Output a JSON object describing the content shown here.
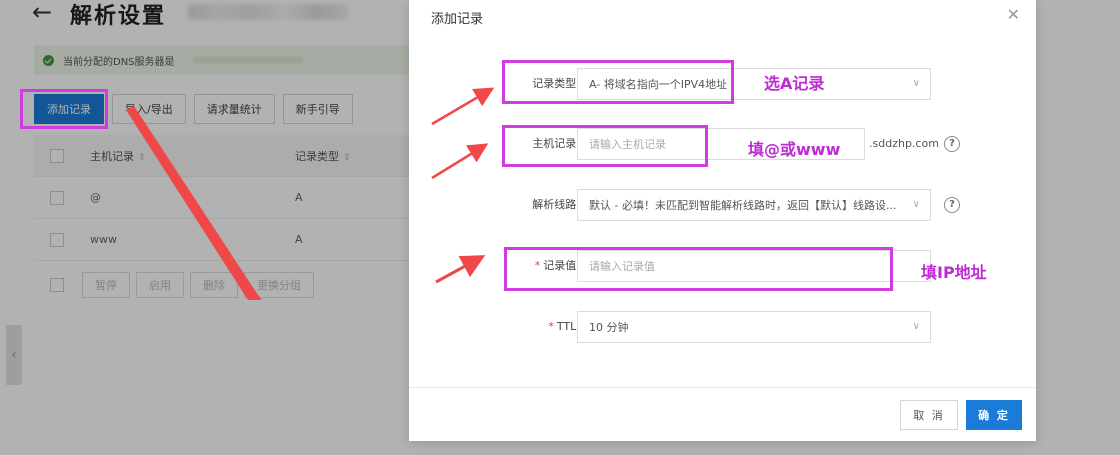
{
  "page": {
    "back_icon": "arrow-left-icon",
    "title": "解析设置",
    "dns_notice": "当前分配的DNS服务器是"
  },
  "toolbar": {
    "add_record": "添加记录",
    "import_export": "导入/导出",
    "request_stats": "请求量统计",
    "guide": "新手引导"
  },
  "table": {
    "headers": {
      "host": "主机记录",
      "type": "记录类型"
    },
    "rows": [
      {
        "host": "@",
        "type": "A"
      },
      {
        "host": "www",
        "type": "A"
      }
    ]
  },
  "bulk_actions": {
    "pause": "暂停",
    "enable": "启用",
    "delete": "删除",
    "change_group": "更换分组"
  },
  "dialog": {
    "title": "添加记录",
    "close_icon": "close-icon",
    "fields": {
      "record_type": {
        "label": "记录类型:",
        "value": "A- 将域名指向一个IPV4地址"
      },
      "host_record": {
        "label": "主机记录:",
        "placeholder": "请输入主机记录",
        "suffix": ".sddzhp.com"
      },
      "resolve_line": {
        "label": "解析线路:",
        "value": "默认 - 必填！未匹配到智能解析线路时，返回【默认】线路设..."
      },
      "record_value": {
        "label": "记录值:",
        "placeholder": "请输入记录值",
        "required": true
      },
      "ttl": {
        "label": "TTL:",
        "value": "10 分钟",
        "required": true
      }
    },
    "cancel": "取 消",
    "confirm": "确 定"
  },
  "annotations": {
    "choose_a": "选A记录",
    "fill_host": "填@或www",
    "fill_ip": "填IP地址"
  },
  "colors": {
    "primary": "#1a7bd8",
    "annotation": "#d13ce0",
    "arrow": "#f04848"
  }
}
